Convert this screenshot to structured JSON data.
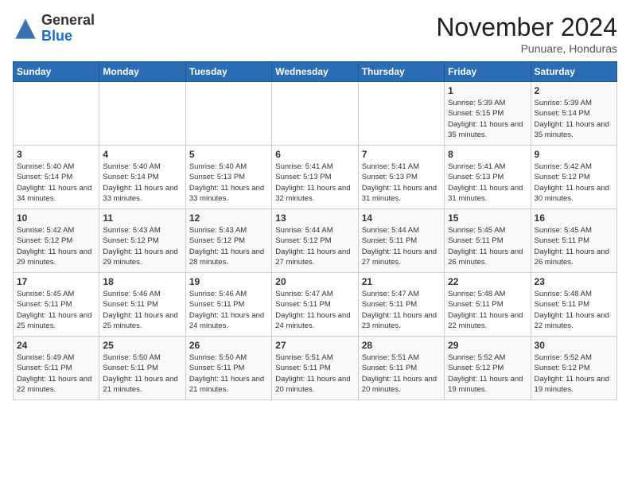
{
  "header": {
    "logo_general": "General",
    "logo_blue": "Blue",
    "month_title": "November 2024",
    "location": "Punuare, Honduras"
  },
  "days_of_week": [
    "Sunday",
    "Monday",
    "Tuesday",
    "Wednesday",
    "Thursday",
    "Friday",
    "Saturday"
  ],
  "weeks": [
    [
      {
        "day": "",
        "info": ""
      },
      {
        "day": "",
        "info": ""
      },
      {
        "day": "",
        "info": ""
      },
      {
        "day": "",
        "info": ""
      },
      {
        "day": "",
        "info": ""
      },
      {
        "day": "1",
        "info": "Sunrise: 5:39 AM\nSunset: 5:15 PM\nDaylight: 11 hours and 35 minutes."
      },
      {
        "day": "2",
        "info": "Sunrise: 5:39 AM\nSunset: 5:14 PM\nDaylight: 11 hours and 35 minutes."
      }
    ],
    [
      {
        "day": "3",
        "info": "Sunrise: 5:40 AM\nSunset: 5:14 PM\nDaylight: 11 hours and 34 minutes."
      },
      {
        "day": "4",
        "info": "Sunrise: 5:40 AM\nSunset: 5:14 PM\nDaylight: 11 hours and 33 minutes."
      },
      {
        "day": "5",
        "info": "Sunrise: 5:40 AM\nSunset: 5:13 PM\nDaylight: 11 hours and 33 minutes."
      },
      {
        "day": "6",
        "info": "Sunrise: 5:41 AM\nSunset: 5:13 PM\nDaylight: 11 hours and 32 minutes."
      },
      {
        "day": "7",
        "info": "Sunrise: 5:41 AM\nSunset: 5:13 PM\nDaylight: 11 hours and 31 minutes."
      },
      {
        "day": "8",
        "info": "Sunrise: 5:41 AM\nSunset: 5:13 PM\nDaylight: 11 hours and 31 minutes."
      },
      {
        "day": "9",
        "info": "Sunrise: 5:42 AM\nSunset: 5:12 PM\nDaylight: 11 hours and 30 minutes."
      }
    ],
    [
      {
        "day": "10",
        "info": "Sunrise: 5:42 AM\nSunset: 5:12 PM\nDaylight: 11 hours and 29 minutes."
      },
      {
        "day": "11",
        "info": "Sunrise: 5:43 AM\nSunset: 5:12 PM\nDaylight: 11 hours and 29 minutes."
      },
      {
        "day": "12",
        "info": "Sunrise: 5:43 AM\nSunset: 5:12 PM\nDaylight: 11 hours and 28 minutes."
      },
      {
        "day": "13",
        "info": "Sunrise: 5:44 AM\nSunset: 5:12 PM\nDaylight: 11 hours and 27 minutes."
      },
      {
        "day": "14",
        "info": "Sunrise: 5:44 AM\nSunset: 5:11 PM\nDaylight: 11 hours and 27 minutes."
      },
      {
        "day": "15",
        "info": "Sunrise: 5:45 AM\nSunset: 5:11 PM\nDaylight: 11 hours and 26 minutes."
      },
      {
        "day": "16",
        "info": "Sunrise: 5:45 AM\nSunset: 5:11 PM\nDaylight: 11 hours and 26 minutes."
      }
    ],
    [
      {
        "day": "17",
        "info": "Sunrise: 5:45 AM\nSunset: 5:11 PM\nDaylight: 11 hours and 25 minutes."
      },
      {
        "day": "18",
        "info": "Sunrise: 5:46 AM\nSunset: 5:11 PM\nDaylight: 11 hours and 25 minutes."
      },
      {
        "day": "19",
        "info": "Sunrise: 5:46 AM\nSunset: 5:11 PM\nDaylight: 11 hours and 24 minutes."
      },
      {
        "day": "20",
        "info": "Sunrise: 5:47 AM\nSunset: 5:11 PM\nDaylight: 11 hours and 24 minutes."
      },
      {
        "day": "21",
        "info": "Sunrise: 5:47 AM\nSunset: 5:11 PM\nDaylight: 11 hours and 23 minutes."
      },
      {
        "day": "22",
        "info": "Sunrise: 5:48 AM\nSunset: 5:11 PM\nDaylight: 11 hours and 22 minutes."
      },
      {
        "day": "23",
        "info": "Sunrise: 5:48 AM\nSunset: 5:11 PM\nDaylight: 11 hours and 22 minutes."
      }
    ],
    [
      {
        "day": "24",
        "info": "Sunrise: 5:49 AM\nSunset: 5:11 PM\nDaylight: 11 hours and 22 minutes."
      },
      {
        "day": "25",
        "info": "Sunrise: 5:50 AM\nSunset: 5:11 PM\nDaylight: 11 hours and 21 minutes."
      },
      {
        "day": "26",
        "info": "Sunrise: 5:50 AM\nSunset: 5:11 PM\nDaylight: 11 hours and 21 minutes."
      },
      {
        "day": "27",
        "info": "Sunrise: 5:51 AM\nSunset: 5:11 PM\nDaylight: 11 hours and 20 minutes."
      },
      {
        "day": "28",
        "info": "Sunrise: 5:51 AM\nSunset: 5:11 PM\nDaylight: 11 hours and 20 minutes."
      },
      {
        "day": "29",
        "info": "Sunrise: 5:52 AM\nSunset: 5:12 PM\nDaylight: 11 hours and 19 minutes."
      },
      {
        "day": "30",
        "info": "Sunrise: 5:52 AM\nSunset: 5:12 PM\nDaylight: 11 hours and 19 minutes."
      }
    ]
  ]
}
